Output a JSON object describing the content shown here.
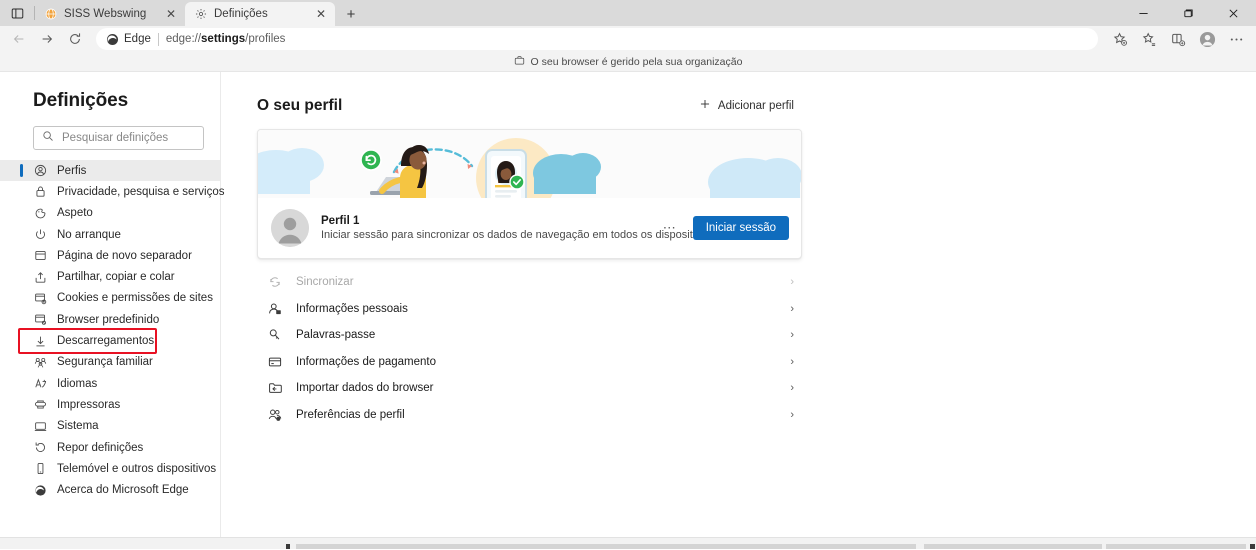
{
  "window": {
    "tabs": [
      {
        "title": "SISS Webswing",
        "favicon": "globe-icon",
        "active": false
      },
      {
        "title": "Definições",
        "favicon": "gear-icon",
        "active": true
      }
    ],
    "new_tab_label": "+",
    "close_label": "✕",
    "controls": {
      "minimize": "—",
      "maximize": "❐",
      "close": "✕"
    }
  },
  "toolbar": {
    "back_label": "←",
    "forward_label": "→",
    "refresh_label": "⟳",
    "brand": "Edge",
    "url_prefix": "edge://",
    "url_bold": "settings",
    "url_suffix": "/profiles",
    "icons": [
      "favorite-star-icon",
      "collections-icon",
      "split-screen-icon",
      "profile-avatar-icon",
      "more-options-icon"
    ]
  },
  "org_banner": {
    "text": "O seu browser é gerido pela sua organização",
    "icon": "briefcase-icon"
  },
  "sidebar": {
    "title": "Definições",
    "search": {
      "placeholder": "Pesquisar definições",
      "icon": "search-icon"
    },
    "items": [
      {
        "label": "Perfis",
        "icon": "profile-icon",
        "selected": true,
        "boxed": false
      },
      {
        "label": "Privacidade, pesquisa e serviços",
        "icon": "lock-icon",
        "selected": false,
        "boxed": false
      },
      {
        "label": "Aspeto",
        "icon": "appearance-icon",
        "selected": false,
        "boxed": false
      },
      {
        "label": "No arranque",
        "icon": "power-icon",
        "selected": false,
        "boxed": false
      },
      {
        "label": "Página de novo separador",
        "icon": "new-tab-page-icon",
        "selected": false,
        "boxed": false
      },
      {
        "label": "Partilhar, copiar e colar",
        "icon": "share-icon",
        "selected": false,
        "boxed": false
      },
      {
        "label": "Cookies e permissões de sites",
        "icon": "cookies-icon",
        "selected": false,
        "boxed": false
      },
      {
        "label": "Browser predefinido",
        "icon": "default-browser-icon",
        "selected": false,
        "boxed": false
      },
      {
        "label": "Descarregamentos",
        "icon": "download-icon",
        "selected": false,
        "boxed": true
      },
      {
        "label": "Segurança familiar",
        "icon": "family-icon",
        "selected": false,
        "boxed": false
      },
      {
        "label": "Idiomas",
        "icon": "languages-icon",
        "selected": false,
        "boxed": false
      },
      {
        "label": "Impressoras",
        "icon": "printer-icon",
        "selected": false,
        "boxed": false
      },
      {
        "label": "Sistema",
        "icon": "system-icon",
        "selected": false,
        "boxed": false
      },
      {
        "label": "Repor definições",
        "icon": "reset-icon",
        "selected": false,
        "boxed": false
      },
      {
        "label": "Telemóvel e outros dispositivos",
        "icon": "phone-icon",
        "selected": false,
        "boxed": false
      },
      {
        "label": "Acerca do Microsoft Edge",
        "icon": "edge-logo-icon",
        "selected": false,
        "boxed": false
      }
    ]
  },
  "main": {
    "title": "O seu perfil",
    "add_profile_label": "Adicionar perfil",
    "add_profile_icon": "plus-icon",
    "profile_card": {
      "name": "Perfil 1",
      "description": "Iniciar sessão para sincronizar os dados de navegação em todos os dispositivos",
      "more_label": "⋯",
      "signin_label": "Iniciar sessão",
      "avatar_icon": "person-avatar-icon",
      "banner_illustration": "sync-devices-illustration"
    },
    "rows": [
      {
        "label": "Sincronizar",
        "icon": "sync-icon",
        "disabled": true,
        "chevron": "›"
      },
      {
        "label": "Informações pessoais",
        "icon": "personal-info-icon",
        "disabled": false,
        "chevron": "›"
      },
      {
        "label": "Palavras-passe",
        "icon": "key-icon",
        "disabled": false,
        "chevron": "›"
      },
      {
        "label": "Informações de pagamento",
        "icon": "credit-card-icon",
        "disabled": false,
        "chevron": "›"
      },
      {
        "label": "Importar dados do browser",
        "icon": "import-icon",
        "disabled": false,
        "chevron": "›"
      },
      {
        "label": "Preferências de perfil",
        "icon": "profile-prefs-icon",
        "disabled": false,
        "chevron": "›"
      }
    ]
  },
  "colors": {
    "accent": "#0f6cbd",
    "highlight_box": "#e81123",
    "tab_inactive": "#dadada",
    "tab_active": "#f3f3f3",
    "sidebar_selected": "#ebebeb"
  }
}
